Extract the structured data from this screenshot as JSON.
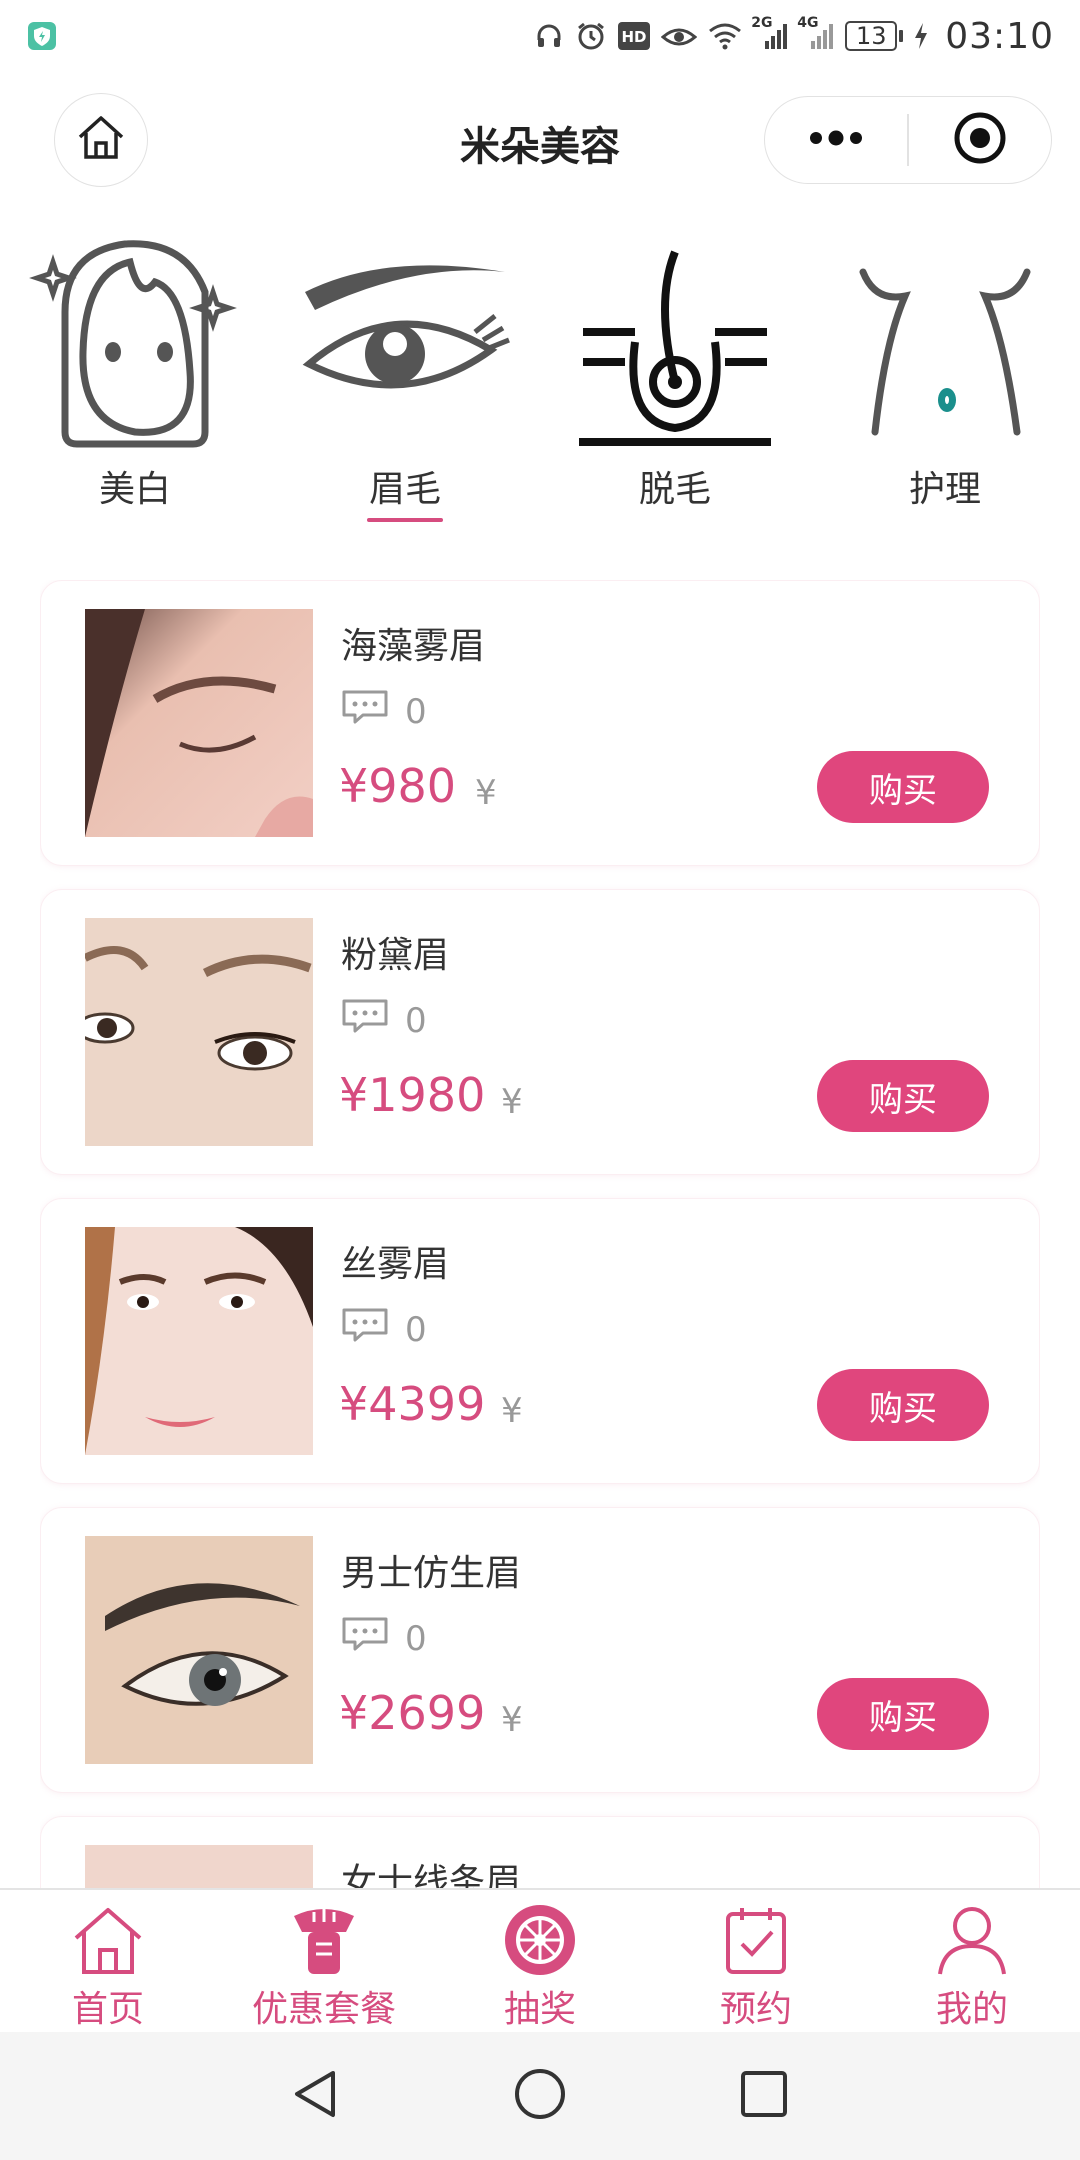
{
  "status_bar": {
    "net_2g": "2G",
    "net_4g": "4G",
    "hd": "HD",
    "battery": "13",
    "time": "03:10"
  },
  "header": {
    "title": "米朵美容"
  },
  "categories": [
    {
      "label": "美白",
      "icon": "face-whitening-icon",
      "selected": false
    },
    {
      "label": "眉毛",
      "icon": "eye-eyebrow-icon",
      "selected": true
    },
    {
      "label": "脱毛",
      "icon": "hair-removal-icon",
      "selected": false
    },
    {
      "label": "护理",
      "icon": "body-care-icon",
      "selected": false
    }
  ],
  "products": [
    {
      "name": "海藻雾眉",
      "comments": "0",
      "price": "¥980",
      "suffix": "¥",
      "button": "购买"
    },
    {
      "name": "粉黛眉",
      "comments": "0",
      "price": "¥1980",
      "suffix": "¥",
      "button": "购买"
    },
    {
      "name": "丝雾眉",
      "comments": "0",
      "price": "¥4399",
      "suffix": "¥",
      "button": "购买"
    },
    {
      "name": "男士仿生眉",
      "comments": "0",
      "price": "¥2699",
      "suffix": "¥",
      "button": "购买"
    },
    {
      "name": "女士线条眉"
    }
  ],
  "tabbar": [
    {
      "label": "首页",
      "icon": "home-icon"
    },
    {
      "label": "优惠套餐",
      "icon": "package-icon"
    },
    {
      "label": "抽奖",
      "icon": "lottery-wheel-icon"
    },
    {
      "label": "预约",
      "icon": "calendar-check-icon"
    },
    {
      "label": "我的",
      "icon": "user-icon"
    }
  ],
  "colors": {
    "accent": "#d64c7f",
    "button": "#e0467d",
    "muted": "#999999",
    "text": "#333333"
  }
}
